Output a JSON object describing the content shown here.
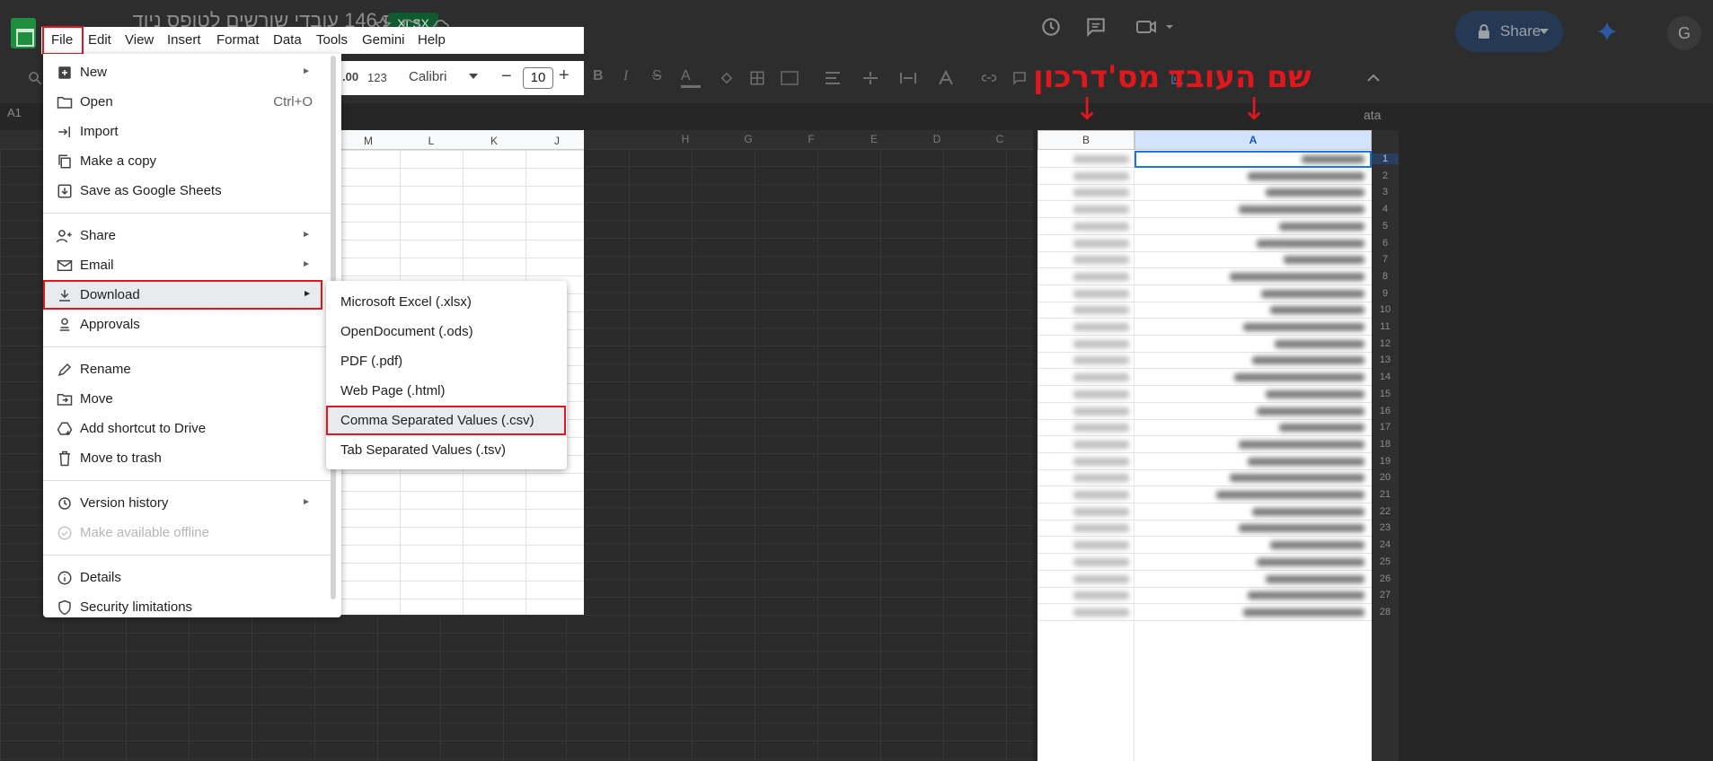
{
  "document": {
    "title": "שמות 146 עובדי שורשים לטופס ניוד",
    "badge": "XLSX"
  },
  "topbar": {
    "share_label": "Share",
    "avatar_letter": "G",
    "icons": [
      "star-icon",
      "move-to-folder-icon",
      "cloud-status-icon",
      "history-icon",
      "comments-icon",
      "meet-icon",
      "lock-icon",
      "gemini-icon"
    ]
  },
  "menubar": {
    "items": [
      "File",
      "Edit",
      "View",
      "Insert",
      "Format",
      "Data",
      "Tools",
      "Gemini",
      "Help"
    ]
  },
  "toolbar": {
    "decimal_label": ".00",
    "number_format_label": "123",
    "font_name": "Calibri",
    "font_size": "10",
    "minus": "−",
    "plus": "+",
    "overflow_text": "ata"
  },
  "namebox": {
    "value": "A1"
  },
  "grid": {
    "dim_columns": [
      "H",
      "G",
      "F",
      "E",
      "D",
      "C"
    ],
    "light_columns": [
      "M",
      "L",
      "K",
      "J"
    ],
    "right_columns": {
      "b": "B",
      "a": "A"
    },
    "row_numbers": [
      "1",
      "2",
      "3",
      "4",
      "5",
      "6",
      "7",
      "8",
      "9",
      "10",
      "11",
      "12",
      "13",
      "14",
      "15",
      "16",
      "17",
      "18",
      "19",
      "20",
      "21",
      "22",
      "23",
      "24",
      "25",
      "26",
      "27",
      "28"
    ]
  },
  "annotations": {
    "employee_name": "שם העובד",
    "passport_number": "מס'דרכון",
    "arrow": "↓"
  },
  "file_menu": {
    "items": [
      {
        "label": "New",
        "icon": "new-sheet-icon",
        "submenu": true
      },
      {
        "label": "Open",
        "icon": "folder-icon",
        "shortcut": "Ctrl+O"
      },
      {
        "label": "Import",
        "icon": "import-icon"
      },
      {
        "label": "Make a copy",
        "icon": "copy-icon"
      },
      {
        "label": "Save as Google Sheets",
        "icon": "save-icon"
      },
      {
        "label": "Share",
        "icon": "share-person-icon",
        "submenu": true
      },
      {
        "label": "Email",
        "icon": "mail-icon",
        "submenu": true
      },
      {
        "label": "Download",
        "icon": "download-icon",
        "submenu": true
      },
      {
        "label": "Approvals",
        "icon": "approvals-icon"
      },
      {
        "label": "Rename",
        "icon": "pencil-icon"
      },
      {
        "label": "Move",
        "icon": "move-folder-icon"
      },
      {
        "label": "Add shortcut to Drive",
        "icon": "drive-shortcut-icon"
      },
      {
        "label": "Move to trash",
        "icon": "trash-icon"
      },
      {
        "label": "Version history",
        "icon": "history-icon",
        "submenu": true
      },
      {
        "label": "Make available offline",
        "icon": "offline-icon",
        "disabled": true
      },
      {
        "label": "Details",
        "icon": "info-icon"
      },
      {
        "label": "Security limitations",
        "icon": "security-icon"
      }
    ],
    "submenu_marker": "►"
  },
  "download_menu": {
    "items": [
      "Microsoft Excel (.xlsx)",
      "OpenDocument (.ods)",
      "PDF (.pdf)",
      "Web Page (.html)",
      "Comma Separated Values (.csv)",
      "Tab Separated Values (.tsv)"
    ]
  },
  "colors": {
    "highlight": "#e0171c",
    "selection": "#1a73e8",
    "overlay": "#262626"
  }
}
